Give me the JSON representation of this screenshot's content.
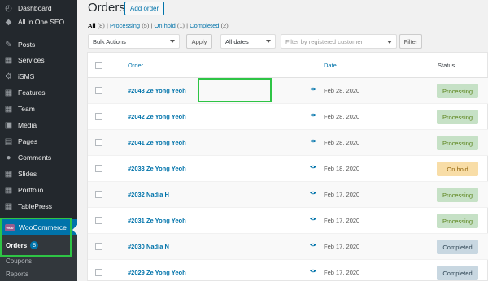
{
  "sidebar": {
    "items": [
      {
        "label": "Dashboard",
        "icon": "dashboard-icon",
        "glyph": "◴"
      },
      {
        "label": "All in One SEO",
        "icon": "seo-icon",
        "glyph": "◆"
      },
      {
        "label": "Posts",
        "icon": "pin-icon",
        "glyph": "✎"
      },
      {
        "label": "Services",
        "icon": "services-icon",
        "glyph": "▦"
      },
      {
        "label": "iSMS",
        "icon": "gear-icon",
        "glyph": "⚙"
      },
      {
        "label": "Features",
        "icon": "features-icon",
        "glyph": "▦"
      },
      {
        "label": "Team",
        "icon": "team-icon",
        "glyph": "▦"
      },
      {
        "label": "Media",
        "icon": "media-icon",
        "glyph": "▣"
      },
      {
        "label": "Pages",
        "icon": "pages-icon",
        "glyph": "▤"
      },
      {
        "label": "Comments",
        "icon": "comment-icon",
        "glyph": "●"
      },
      {
        "label": "Slides",
        "icon": "slides-icon",
        "glyph": "▦"
      },
      {
        "label": "Portfolio",
        "icon": "portfolio-icon",
        "glyph": "▦"
      },
      {
        "label": "TablePress",
        "icon": "table-icon",
        "glyph": "▦"
      }
    ],
    "woocommerce": {
      "label": "WooCommerce",
      "icon_text": "woo"
    },
    "submenu": {
      "orders_label": "Orders",
      "orders_badge": "5",
      "coupons_label": "Coupons",
      "reports_label": "Reports"
    }
  },
  "header": {
    "title": "Orders",
    "add_order_label": "Add order"
  },
  "views": {
    "all": "All",
    "all_count": "(8)",
    "sep1": " | ",
    "processing": "Processing",
    "processing_count": "(5)",
    "sep2": " | ",
    "onhold": "On hold",
    "onhold_count": "(1)",
    "sep3": " | ",
    "completed": "Completed",
    "completed_count": "(2)"
  },
  "filters": {
    "bulk_actions": "Bulk Actions",
    "apply_label": "Apply",
    "dates": "All dates",
    "customer_placeholder": "Filter by registered customer",
    "filter_label": "Filter"
  },
  "table": {
    "columns": {
      "order": "Order",
      "date": "Date",
      "status": "Status"
    },
    "rows": [
      {
        "order": "#2043 Ze Yong Yeoh",
        "date": "Feb 28, 2020",
        "status": "Processing"
      },
      {
        "order": "#2042 Ze Yong Yeoh",
        "date": "Feb 28, 2020",
        "status": "Processing"
      },
      {
        "order": "#2041 Ze Yong Yeoh",
        "date": "Feb 28, 2020",
        "status": "Processing"
      },
      {
        "order": "#2033 Ze Yong Yeoh",
        "date": "Feb 18, 2020",
        "status": "On hold"
      },
      {
        "order": "#2032 Nadia H",
        "date": "Feb 17, 2020",
        "status": "Processing"
      },
      {
        "order": "#2031 Ze Yong Yeoh",
        "date": "Feb 17, 2020",
        "status": "Processing"
      },
      {
        "order": "#2030 Nadia N",
        "date": "Feb 17, 2020",
        "status": "Completed"
      },
      {
        "order": "#2029 Ze Yong Yeoh",
        "date": "Feb 17, 2020",
        "status": "Completed"
      }
    ]
  },
  "colors": {
    "sidebar_bg": "#23282d",
    "accent": "#0073aa",
    "highlight": "#2ec445",
    "processing_bg": "#c6e1c6",
    "processing_text": "#5b841b",
    "onhold_bg": "#f8dda7",
    "onhold_text": "#94660c",
    "completed_bg": "#c8d7e1",
    "completed_text": "#2e4453"
  }
}
